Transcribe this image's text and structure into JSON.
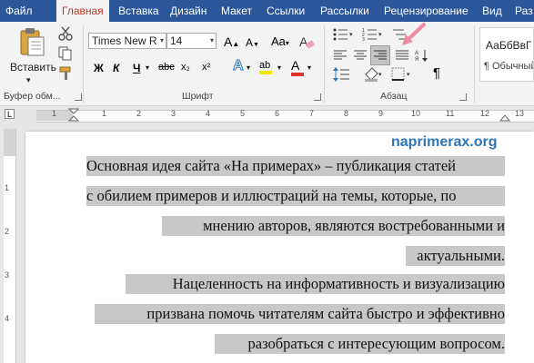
{
  "menu": {
    "tabs": [
      "Файл",
      "Главная",
      "Вставка",
      "Дизайн",
      "Макет",
      "Ссылки",
      "Рассылки",
      "Рецензирование",
      "Вид",
      "Раз"
    ],
    "active_index": 1
  },
  "clipboard": {
    "paste_label": "Вставить",
    "group_label": "Буфер обм..."
  },
  "font": {
    "name_value": "Times New R",
    "size_value": "14",
    "bold": "Ж",
    "italic": "К",
    "underline": "Ч",
    "strike": "abc",
    "subscript": "x₂",
    "superscript": "x²",
    "grow": "A",
    "shrink": "A",
    "case": "Aa",
    "text_effects": "A",
    "highlight": "ab",
    "font_color": "A",
    "group_label": "Шрифт",
    "font_color_hex": "#e03030",
    "highlight_hex": "#f5e600"
  },
  "paragraph": {
    "group_label": "Абзац",
    "pilcrow": "¶"
  },
  "styles": {
    "sample": "АаБбВвГ",
    "name": "¶ Обычный"
  },
  "ruler": {
    "numbers": [
      "1",
      "1",
      "2",
      "3",
      "4",
      "5",
      "6",
      "7",
      "8",
      "9",
      "10",
      "11",
      "12",
      "13"
    ],
    "vertical": [
      "1",
      "2",
      "3",
      "4"
    ]
  },
  "document": {
    "watermark": "naprimerax.org",
    "lines": [
      "Основная идея сайта «На примерах» – публикация статей",
      "с обилием примеров и иллюстраций на темы, которые, по",
      "мнению авторов, являются востребованными и",
      "актуальными.",
      "Нацеленность на информативность и визуализацию",
      "призвана помочь читателям сайта быстро и эффективно",
      "разобраться с интересующим вопросом."
    ]
  },
  "colors": {
    "accent": "#2b579a",
    "active_tab_text": "#c0392b",
    "selection": "#c8c8c8",
    "arrow": "#f08aa0"
  }
}
